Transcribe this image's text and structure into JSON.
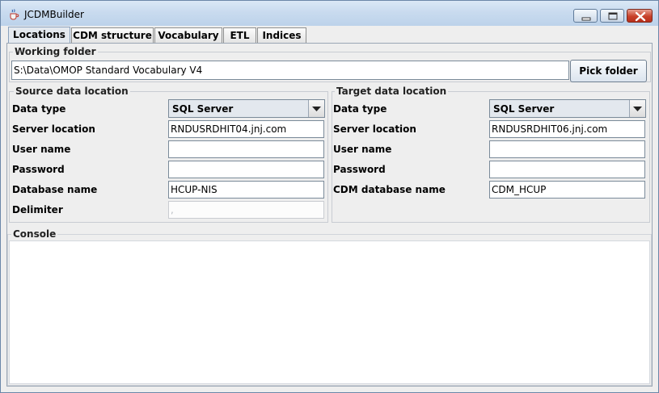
{
  "window": {
    "title": "JCDMBuilder"
  },
  "tabs": [
    {
      "label": "Locations"
    },
    {
      "label": "CDM structure"
    },
    {
      "label": "Vocabulary"
    },
    {
      "label": "ETL"
    },
    {
      "label": "Indices"
    }
  ],
  "working_folder": {
    "title": "Working folder",
    "path": "S:\\Data\\OMOP Standard Vocabulary V4",
    "pick_button": "Pick folder"
  },
  "source": {
    "title": "Source data location",
    "data_type_label": "Data type",
    "data_type_value": "SQL Server",
    "server_label": "Server location",
    "server_value": "RNDUSRDHIT04.jnj.com",
    "user_label": "User name",
    "user_value": "",
    "password_label": "Password",
    "password_value": "",
    "database_label": "Database name",
    "database_value": "HCUP-NIS",
    "delimiter_label": "Delimiter",
    "delimiter_value": ","
  },
  "target": {
    "title": "Target data location",
    "data_type_label": "Data type",
    "data_type_value": "SQL Server",
    "server_label": "Server location",
    "server_value": "RNDUSRDHIT06.jnj.com",
    "user_label": "User name",
    "user_value": "",
    "password_label": "Password",
    "password_value": "",
    "database_label": "CDM database name",
    "database_value": "CDM_HCUP"
  },
  "console": {
    "title": "Console",
    "text": ""
  },
  "icons": {
    "app": "java-cup-icon",
    "minimize": "minimize-icon",
    "maximize": "maximize-icon",
    "close": "close-icon",
    "dropdown": "chevron-down-icon"
  }
}
